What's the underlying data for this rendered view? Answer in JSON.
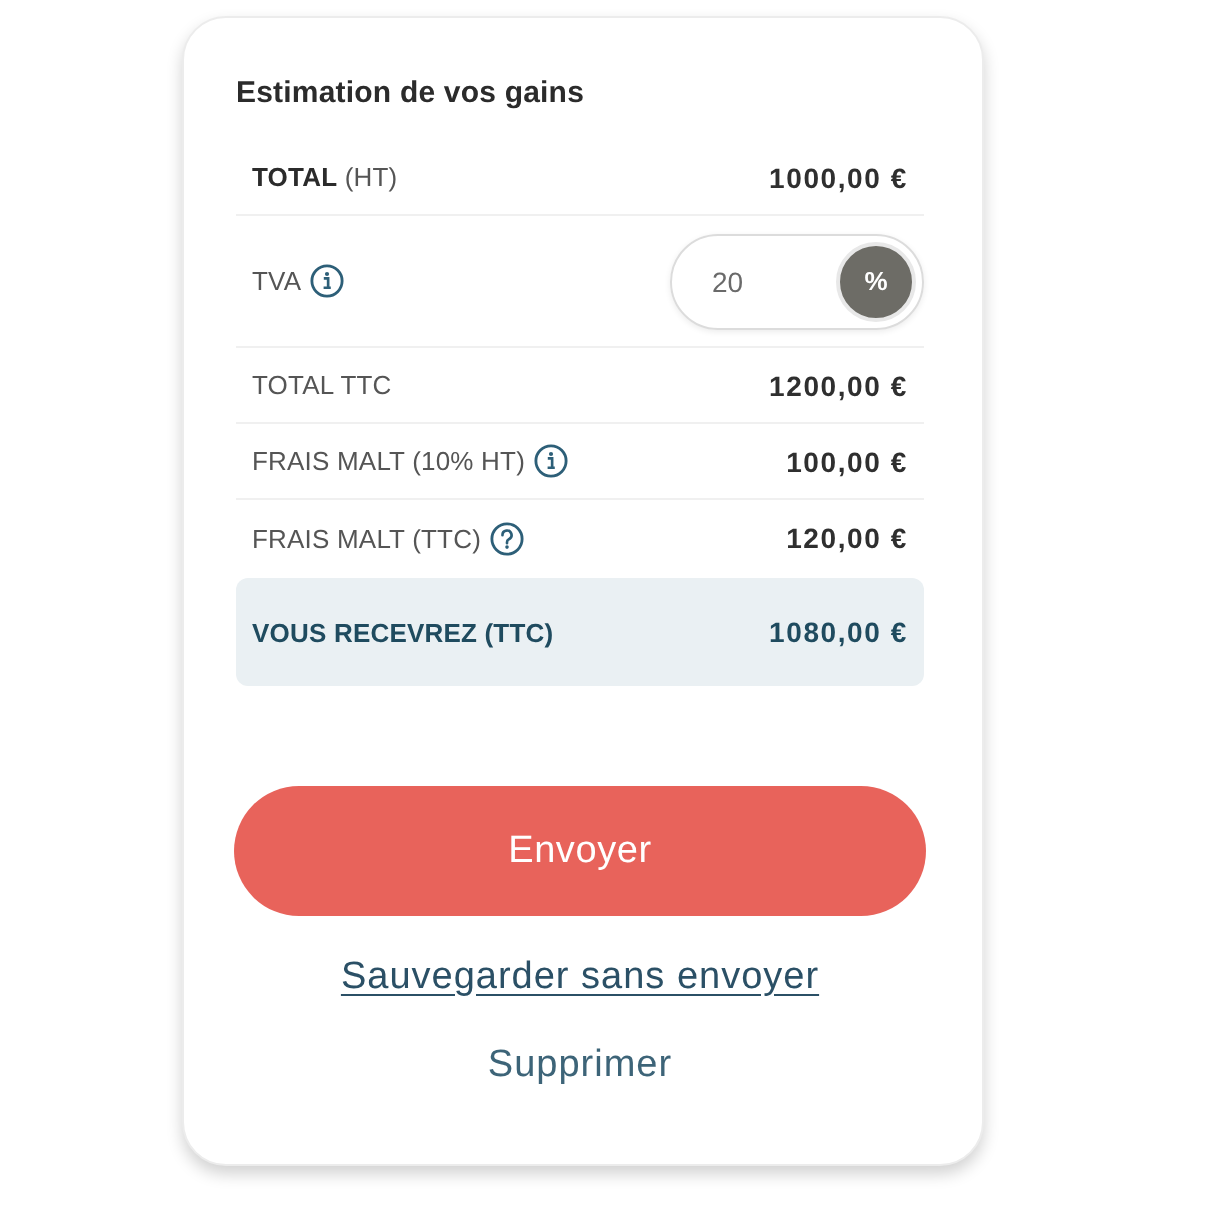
{
  "card": {
    "title": "Estimation de vos gains",
    "rows": [
      {
        "kind": "amount",
        "label": "**TOTAL** (HT)",
        "value": "1000,00 €"
      },
      {
        "kind": "input",
        "label": "TVA",
        "hint": {
          "kind": "info"
        },
        "field": {
          "value": "20",
          "unit": "%"
        }
      },
      {
        "kind": "amount",
        "label": "TOTAL TTC",
        "value": "1200,00 €"
      },
      {
        "kind": "amount",
        "label": "FRAIS MALT (10% HT)",
        "hint": {
          "kind": "info"
        },
        "value": "100,00 €"
      },
      {
        "kind": "amount",
        "label": "FRAIS MALT (TTC)",
        "hint": {
          "kind": "question"
        },
        "value": "120,00 €"
      },
      {
        "kind": "total",
        "label": "VOUS RECEVREZ (TTC)",
        "value": "1080,00 €"
      }
    ],
    "actions": [
      {
        "kind": "primary",
        "label": "Envoyer"
      },
      {
        "kind": "link",
        "label": "Sauvegarder sans envoyer"
      },
      {
        "kind": "plain",
        "label": "Supprimer"
      }
    ]
  }
}
